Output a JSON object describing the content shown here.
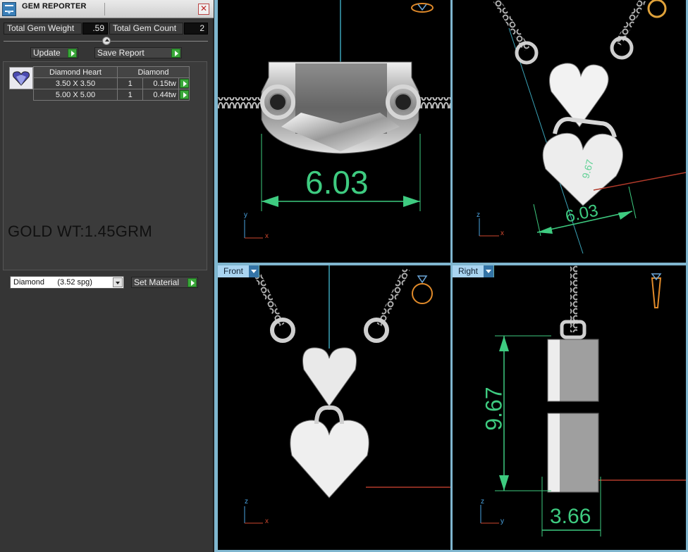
{
  "window": {
    "title": "GEM REPORTER"
  },
  "summary": {
    "total_weight_label": "Total Gem Weight",
    "total_weight_value": ".59",
    "total_count_label": "Total Gem Count",
    "total_count_value": "2"
  },
  "actions": {
    "update_label": "Update",
    "save_report_label": "Save Report"
  },
  "gem_table": {
    "headers": [
      "Diamond Heart",
      "Diamond"
    ],
    "rows": [
      {
        "size": "3.50 X 3.50",
        "qty": "1",
        "weight": "0.15tw"
      },
      {
        "size": "5.00 X 5.00",
        "qty": "1",
        "weight": "0.44tw"
      }
    ]
  },
  "note": "GOLD WT:1.45GRM",
  "material": {
    "selected": "Diamond      (3.52 spg)",
    "set_label": "Set Material"
  },
  "viewports": {
    "top": {
      "dimension": "6.03",
      "axis1": "y",
      "axis2": "x"
    },
    "perspective": {
      "dimension": "6.03",
      "dimension_small": "9.67",
      "axis1": "z",
      "axis2": "x"
    },
    "front": {
      "label": "Front",
      "axis1": "z",
      "axis2": "x"
    },
    "right": {
      "label": "Right",
      "height_dim": "9.67",
      "width_dim": "3.66",
      "axis1": "z",
      "axis2": "y"
    }
  },
  "colors": {
    "dimension": "#3ecb80",
    "tab": "#a9d4f0",
    "axis_x": "#d1482f",
    "axis_y": "#4aa3e0"
  }
}
